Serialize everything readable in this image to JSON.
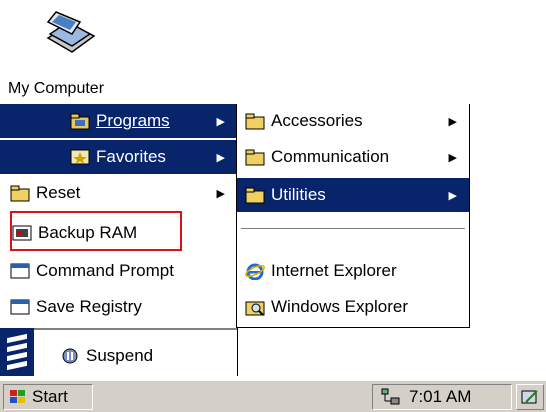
{
  "desktop": {
    "my_computer_label": "My Computer"
  },
  "start_menu": {
    "programs_label": "Programs",
    "favorites_label": "Favorites",
    "reset_label": "Reset",
    "backup_ram_label": "Backup RAM",
    "command_prompt_label": "Command Prompt",
    "save_registry_label": "Save Registry",
    "suspend_label": "Suspend"
  },
  "programs_menu": {
    "accessories_label": "Accessories",
    "communication_label": "Communication",
    "utilities_label": "Utilities",
    "internet_explorer_label": "Internet Explorer",
    "windows_explorer_label": "Windows Explorer"
  },
  "taskbar": {
    "start_label": "Start",
    "clock": "7:01 AM"
  },
  "colors": {
    "selection": "#08246b",
    "taskbar": "#d4d0c8",
    "highlight_box": "#dd1111"
  }
}
